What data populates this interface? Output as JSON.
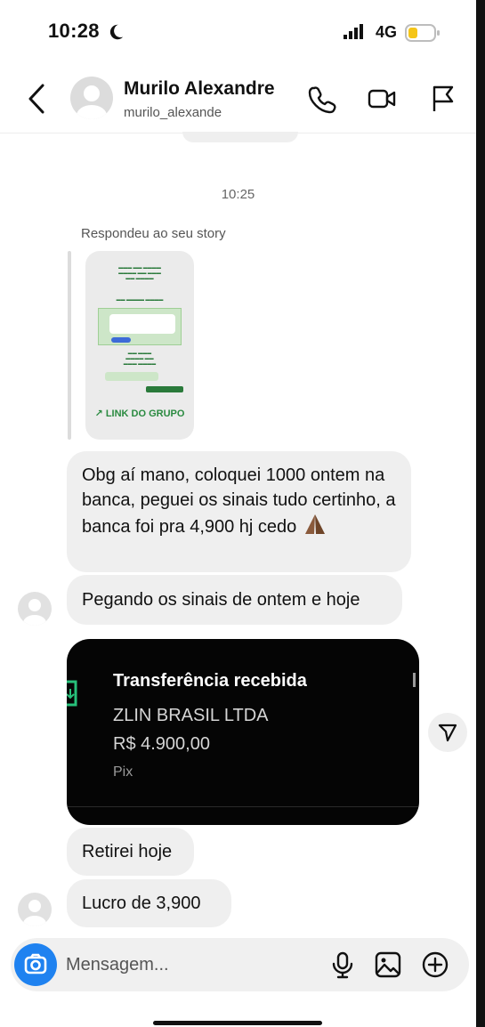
{
  "status_bar": {
    "time": "10:28",
    "network": "4G"
  },
  "header": {
    "name": "Murilo Alexandre",
    "handle": "murilo_alexande"
  },
  "thread": {
    "timestamp": "10:25",
    "story_reply_label": "Respondeu ao seu story",
    "story": {
      "link_text": "↗ LINK DO GRUPO"
    },
    "messages": [
      {
        "text": "Obg aí mano, coloquei 1000 ontem na banca, peguei os sinais tudo certinho, a banca foi pra 4,900 hj cedo"
      },
      {
        "text": "Pegando os sinais de ontem e hoje"
      },
      {
        "text": "Retirei hoje"
      },
      {
        "text": "Lucro de 3,900"
      }
    ],
    "receipt": {
      "title": "Transferência recebida",
      "company": "ZLIN BRASIL LTDA",
      "amount": "R$ 4.900,00",
      "method": "Pix"
    }
  },
  "composer": {
    "placeholder": "Mensagem..."
  },
  "colors": {
    "accent": "#1f82f0",
    "bubble": "#efefef",
    "receipt_bg": "#050505"
  }
}
